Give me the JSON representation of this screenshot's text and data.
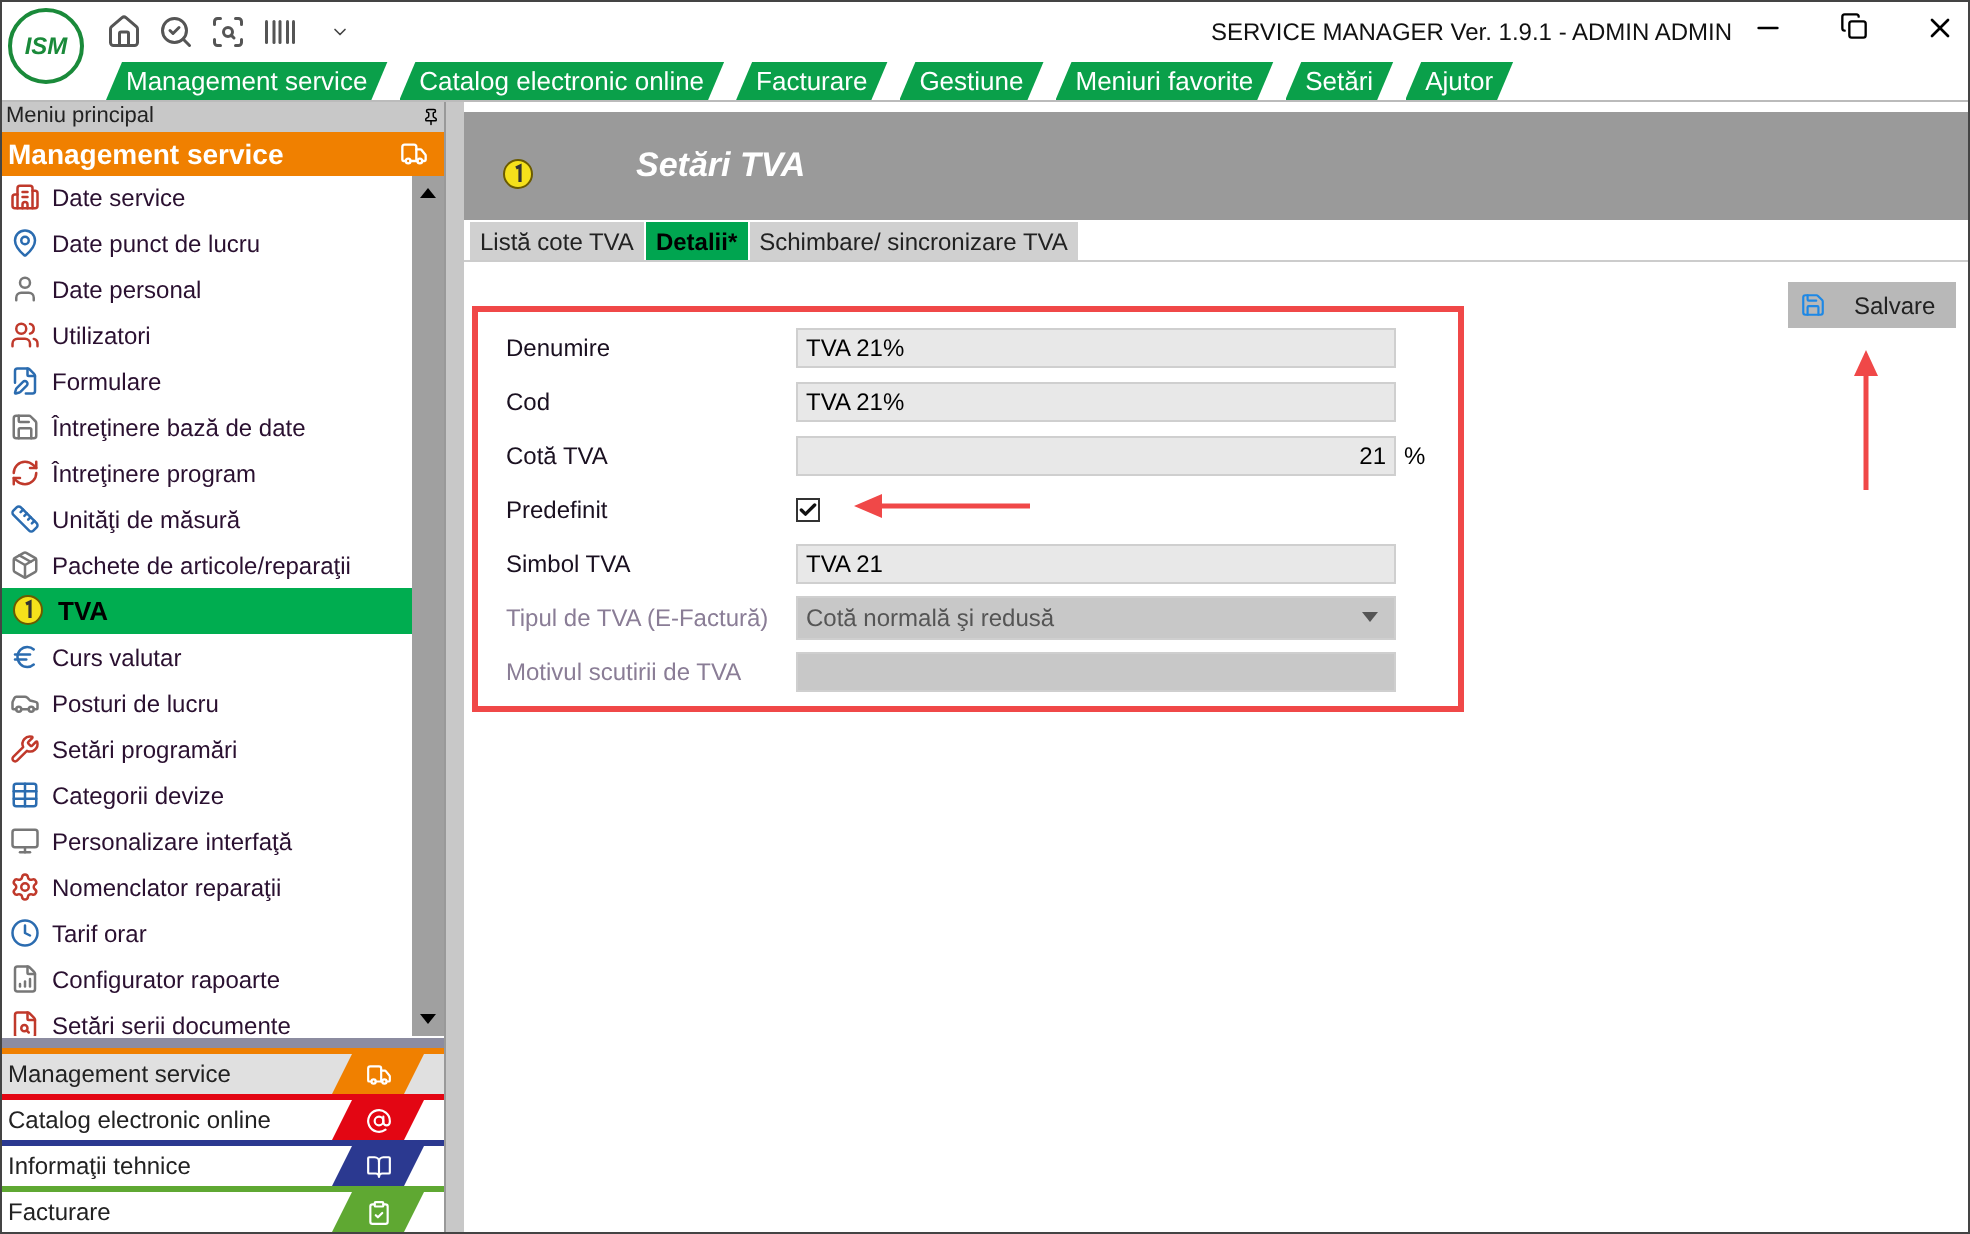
{
  "window": {
    "logo": "ISM",
    "title": "SERVICE MANAGER Ver. 1.9.1 - ADMIN ADMIN"
  },
  "menu_bar": [
    {
      "label": "Management service"
    },
    {
      "label": "Catalog electronic online"
    },
    {
      "label": "Facturare"
    },
    {
      "label": "Gestiune"
    },
    {
      "label": "Meniuri favorite"
    },
    {
      "label": "Setări"
    },
    {
      "label": "Ajutor"
    }
  ],
  "sidebar": {
    "title": "Meniu principal",
    "section": "Management service",
    "items": [
      {
        "label": "Date service",
        "selected": false
      },
      {
        "label": "Date punct de lucru",
        "selected": false
      },
      {
        "label": "Date personal",
        "selected": false
      },
      {
        "label": "Utilizatori",
        "selected": false
      },
      {
        "label": "Formulare",
        "selected": false
      },
      {
        "label": "Întreţinere bază de date",
        "selected": false
      },
      {
        "label": "Întreţinere program",
        "selected": false
      },
      {
        "label": "Unităţi de măsură",
        "selected": false
      },
      {
        "label": "Pachete de articole/reparaţii",
        "selected": false
      },
      {
        "label": "TVA",
        "selected": true
      },
      {
        "label": "Curs valutar",
        "selected": false
      },
      {
        "label": "Posturi de lucru",
        "selected": false
      },
      {
        "label": "Setări programări",
        "selected": false
      },
      {
        "label": "Categorii devize",
        "selected": false
      },
      {
        "label": "Personalizare interfaţă",
        "selected": false
      },
      {
        "label": "Nomenclator reparaţii",
        "selected": false
      },
      {
        "label": "Tarif orar",
        "selected": false
      },
      {
        "label": "Configurator rapoarte",
        "selected": false
      },
      {
        "label": "Setări serii documente",
        "selected": false
      }
    ],
    "modules": [
      {
        "label": "Management service",
        "color": "#f08000",
        "selected": true
      },
      {
        "label": "Catalog electronic online",
        "color": "#e30613",
        "selected": false
      },
      {
        "label": "Informaţii tehnice",
        "color": "#2b3990",
        "selected": false
      },
      {
        "label": "Facturare",
        "color": "#5fa832",
        "selected": false
      }
    ]
  },
  "page": {
    "title": "Setări TVA",
    "tabs": [
      {
        "label": "Listă cote TVA",
        "selected": false
      },
      {
        "label": "Detalii*",
        "selected": true
      },
      {
        "label": "Schimbare/ sincronizare TVA",
        "selected": false
      }
    ],
    "form": [
      {
        "kind": "text",
        "label": "Denumire",
        "value": "TVA 21%",
        "disabled": false
      },
      {
        "kind": "text",
        "label": "Cod",
        "value": "TVA 21%",
        "disabled": false
      },
      {
        "kind": "number",
        "label": "Cotă TVA",
        "value": "21",
        "suffix": "%",
        "disabled": false
      },
      {
        "kind": "checkbox",
        "label": "Predefinit",
        "checked": true,
        "disabled": false
      },
      {
        "kind": "text",
        "label": "Simbol TVA",
        "value": "TVA 21",
        "disabled": false
      },
      {
        "kind": "select",
        "label": "Tipul de TVA (E-Factură)",
        "value": "Cotă normală şi redusă",
        "disabled": true
      },
      {
        "kind": "text",
        "label": "Motivul scutirii de TVA",
        "disabled": true
      }
    ],
    "save_button": "Salvare"
  }
}
